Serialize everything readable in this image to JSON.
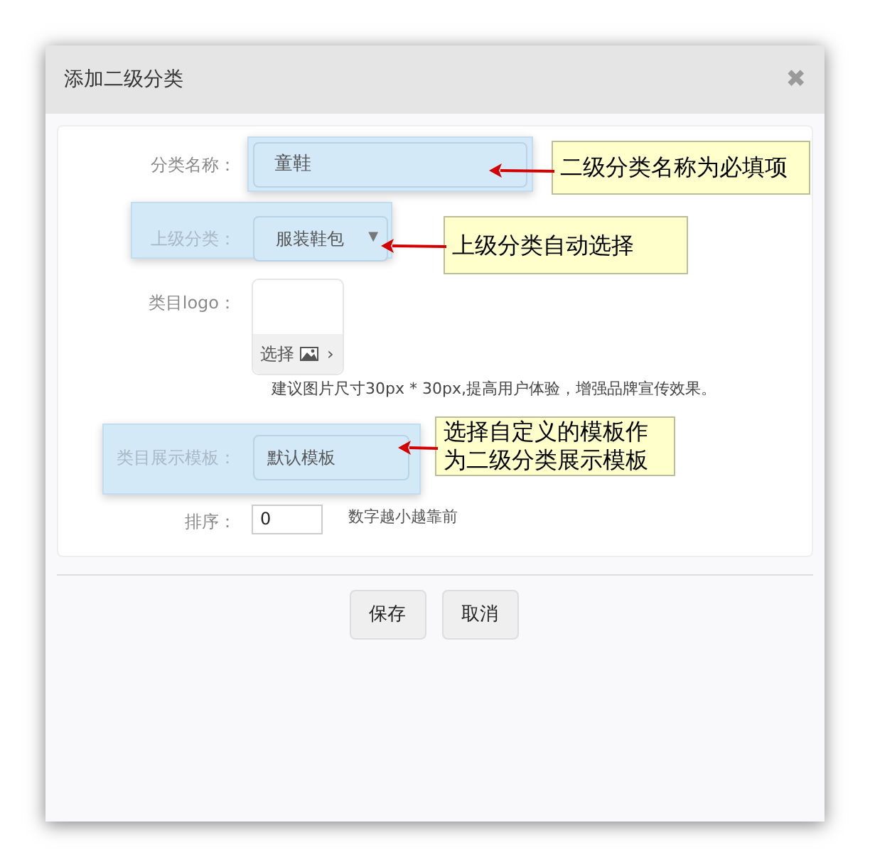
{
  "dialog": {
    "title": "添加二级分类",
    "close": "✖"
  },
  "rows": [
    {
      "kind": "text",
      "label": "分类名称：",
      "value": "童鞋",
      "highlighted": true
    },
    {
      "kind": "select",
      "label": "上级分类：",
      "value": "服装鞋包",
      "caret": "▼",
      "highlighted": true
    },
    {
      "kind": "logo",
      "label": "类目logo：",
      "button": "选择",
      "chevron": "›",
      "hint": "建议图片尺寸30px * 30px,提高用户体验，增强品牌宣传效果。"
    },
    {
      "kind": "template",
      "label": "类目展示模板：",
      "value": "默认模板",
      "highlighted": true
    },
    {
      "kind": "number",
      "label": "排序：",
      "value": "0",
      "hint": "数字越小越靠前"
    }
  ],
  "buttons": [
    "保存",
    "取消"
  ],
  "annotations": [
    {
      "text": "二级分类名称为必填项"
    },
    {
      "text": "上级分类自动选择"
    },
    {
      "text": "选择自定义的模板作为二级分类展示模板"
    }
  ]
}
